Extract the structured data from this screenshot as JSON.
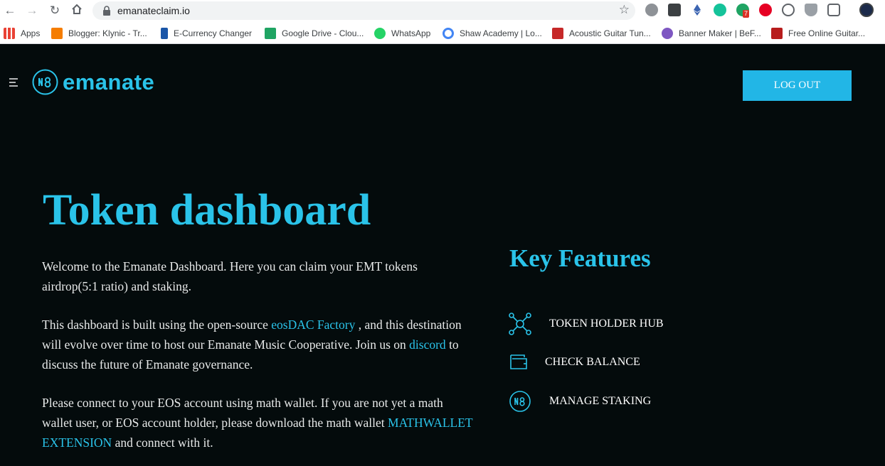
{
  "browser": {
    "url": "emanateclaim.io",
    "bookmarks": [
      {
        "label": "Apps",
        "icon": "apps-grid-icon",
        "color": "#e94235"
      },
      {
        "label": "Blogger: Klynic - Tr...",
        "icon": "blogger-icon",
        "color": "#f57d00"
      },
      {
        "label": "E-Currency Changer",
        "icon": "ecurrency-icon",
        "color": "#1a56a8"
      },
      {
        "label": "Google Drive - Clou...",
        "icon": "google-drive-icon",
        "color": "#1fa463"
      },
      {
        "label": "WhatsApp",
        "icon": "whatsapp-icon",
        "color": "#25d366"
      },
      {
        "label": "Shaw Academy | Lo...",
        "icon": "google-icon",
        "color": "#4285f4"
      },
      {
        "label": "Acoustic Guitar Tun...",
        "icon": "guitar-tuner-icon",
        "color": "#c62828"
      },
      {
        "label": "Banner Maker | BeF...",
        "icon": "befunky-icon",
        "color": "#7e57c2"
      },
      {
        "label": "Free Online Guitar...",
        "icon": "guitar-site-icon",
        "color": "#b71c1c"
      }
    ],
    "extension_badge": "7"
  },
  "site": {
    "brand": "emanate",
    "accent_color": "#2ac3e9",
    "logout_label": "LOG OUT",
    "title": "Token dashboard",
    "intro": "Welcome to the Emanate Dashboard. Here you can claim your EMT tokens airdrop(5:1 ratio) and staking.",
    "para2": {
      "before": "This dashboard is built using the open-source ",
      "link1": "eosDAC Factory",
      "middle": " , and this destination will evolve over time to host our Emanate Music Cooperative. Join us on ",
      "link2": "discord",
      "after": " to discuss the future of Emanate governance."
    },
    "para3": {
      "before": "Please connect to your EOS account using math wallet. If you are not yet a math wallet user, or EOS account holder, please download the math wallet ",
      "link": "MATHWALLET EXTENSION",
      "after": " and connect with it."
    },
    "key_features_title": "Key Features",
    "features": [
      {
        "label": "TOKEN HOLDER HUB",
        "icon": "network-hub-icon"
      },
      {
        "label": "CHECK BALANCE",
        "icon": "wallet-icon"
      },
      {
        "label": "MANAGE STAKING",
        "icon": "emanate-coin-icon"
      }
    ]
  }
}
